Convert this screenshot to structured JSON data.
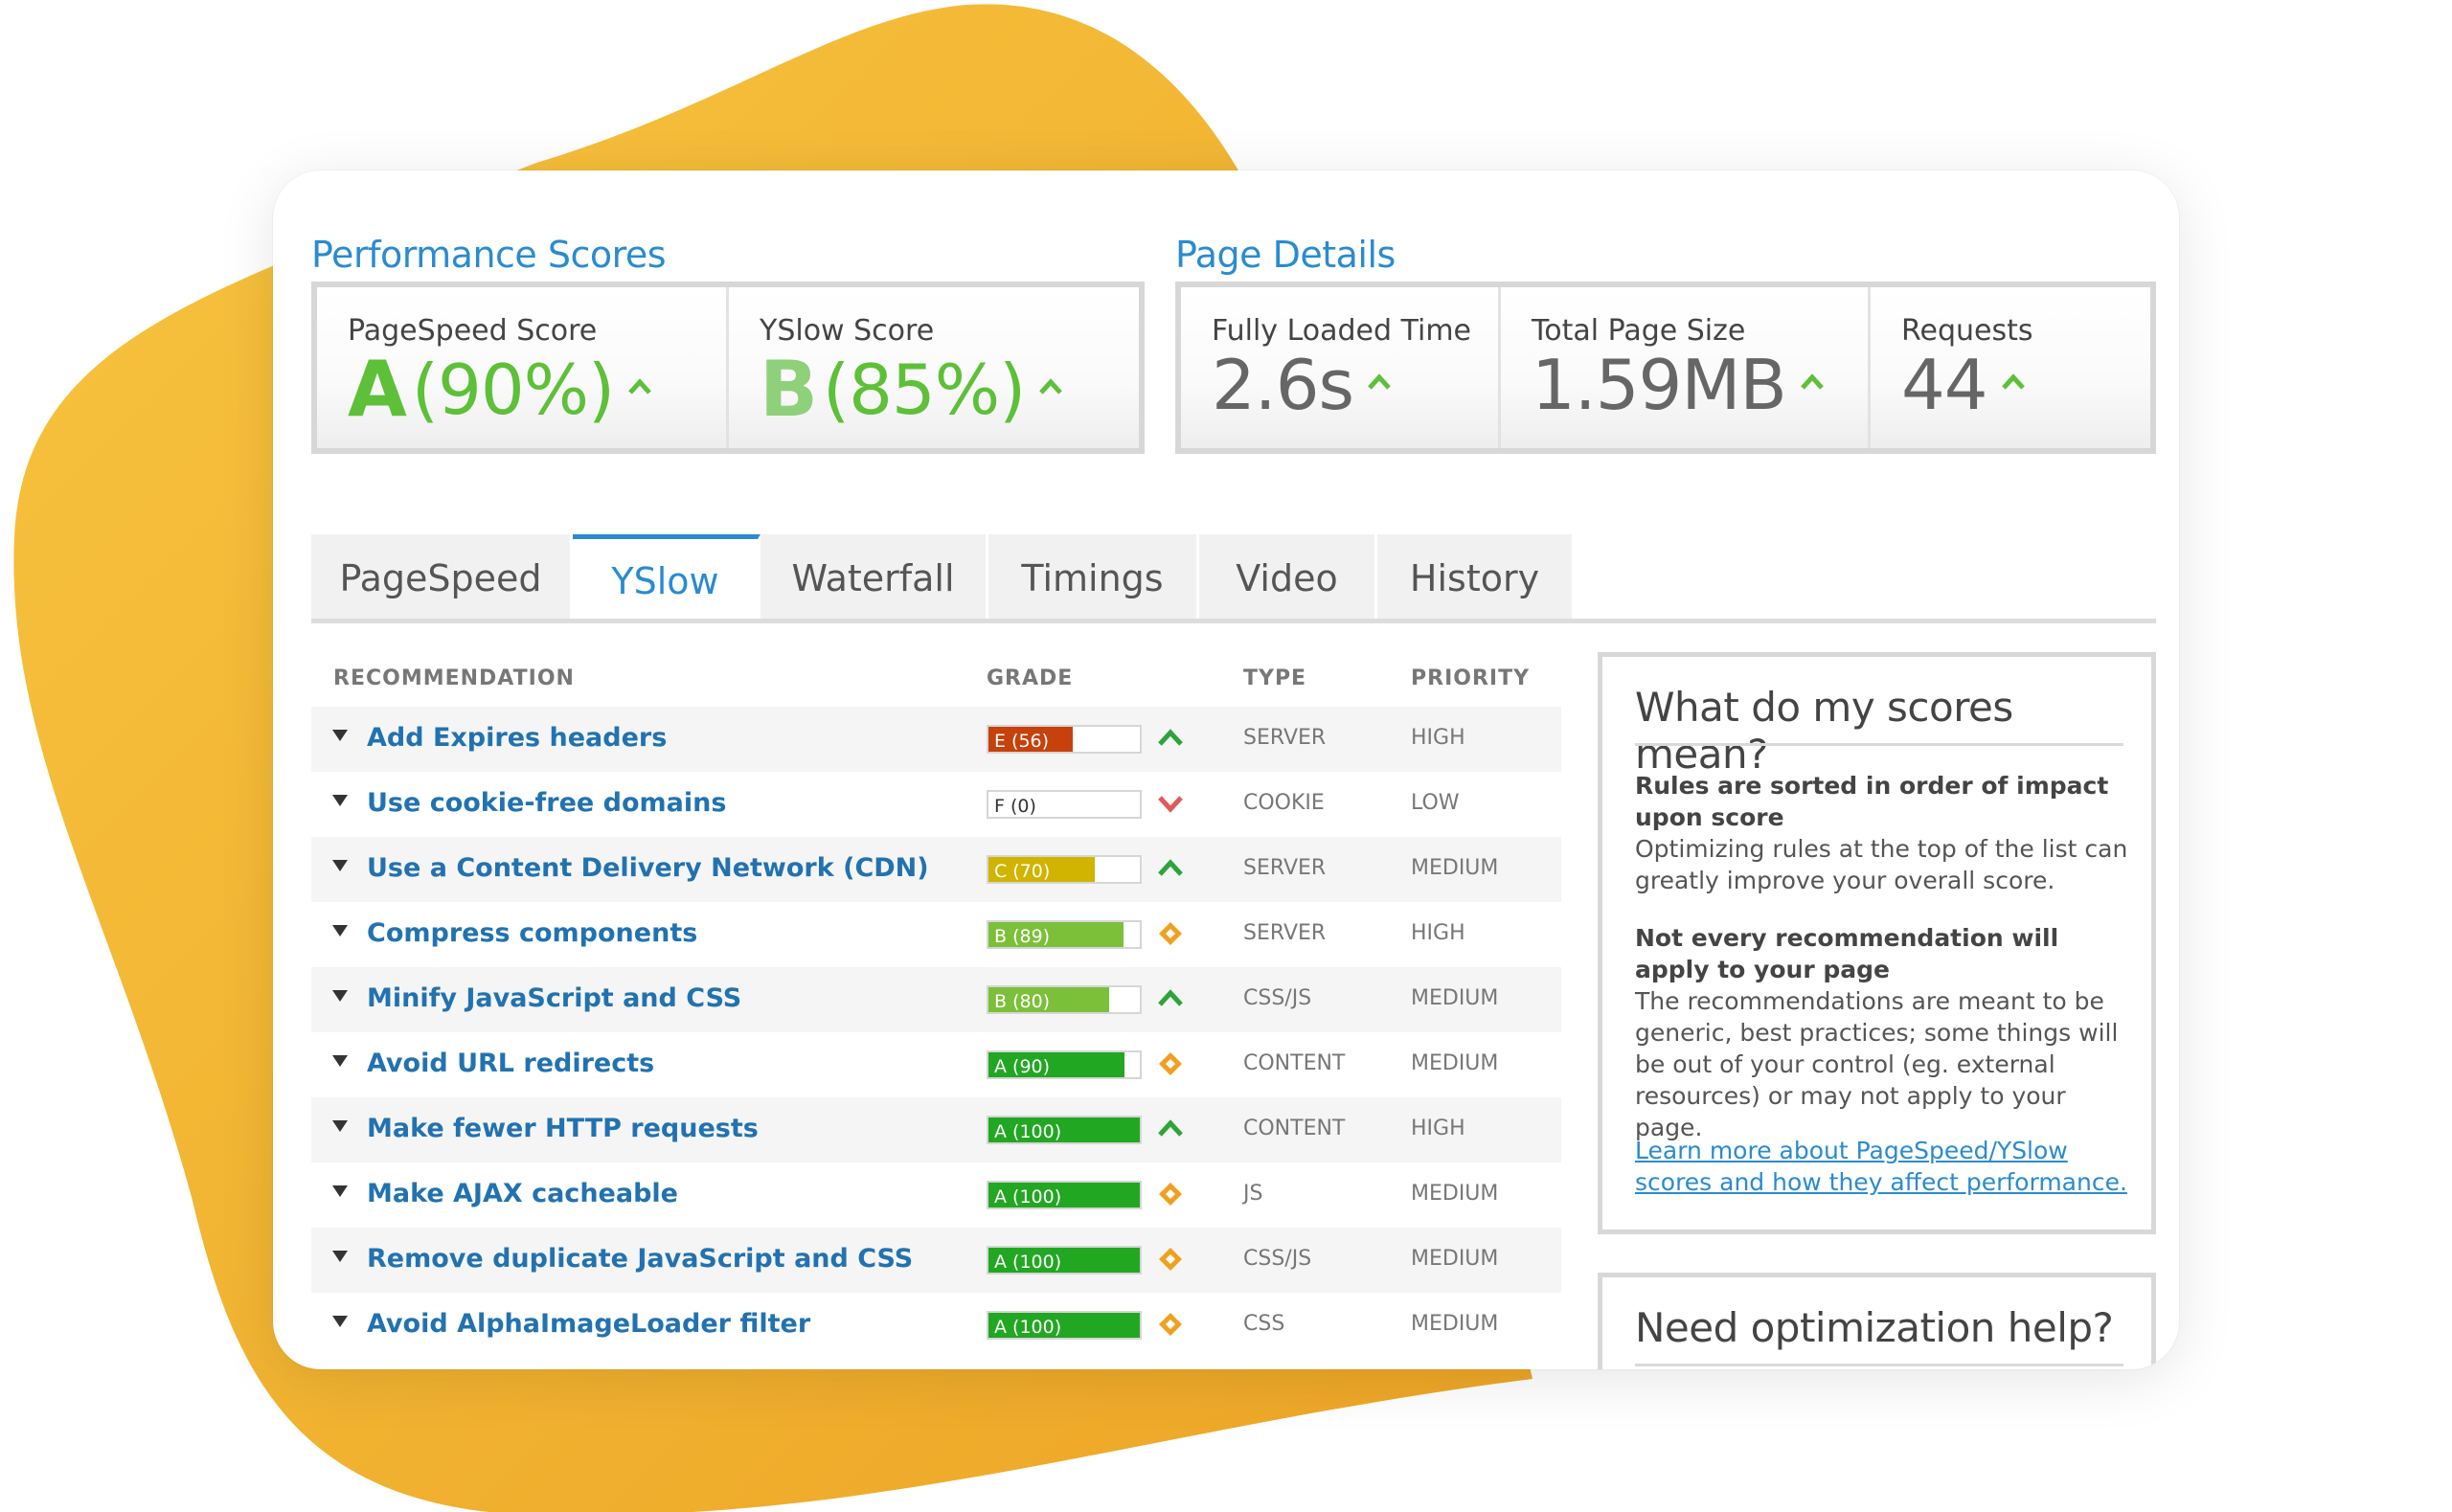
{
  "colors": {
    "blob": "#f4b733",
    "accent": "#2a8bd0",
    "green": "#5dc038",
    "red": "#e05a5a",
    "orange": "#f0a020"
  },
  "performance": {
    "title": "Performance Scores",
    "pagespeed": {
      "label": "PageSpeed Score",
      "grade": "A",
      "percent": "(90%)"
    },
    "yslow": {
      "label": "YSlow Score",
      "grade": "B",
      "percent": "(85%)"
    }
  },
  "details": {
    "title": "Page Details",
    "loaded": {
      "label": "Fully Loaded Time",
      "value": "2.6s"
    },
    "size": {
      "label": "Total Page Size",
      "value": "1.59MB"
    },
    "requests": {
      "label": "Requests",
      "value": "44"
    }
  },
  "tabs": [
    "PageSpeed",
    "YSlow",
    "Waterfall",
    "Timings",
    "Video",
    "History"
  ],
  "active_tab": "YSlow",
  "table": {
    "headers": {
      "recommendation": "RECOMMENDATION",
      "grade": "GRADE",
      "type": "TYPE",
      "priority": "PRIORITY"
    },
    "rows": [
      {
        "name": "Add Expires headers",
        "grade": "E (56)",
        "score": 56,
        "color": "#c6410b",
        "indicator": "up",
        "type": "SERVER",
        "priority": "HIGH"
      },
      {
        "name": "Use cookie-free domains",
        "grade": "F (0)",
        "score": 0,
        "color": "#c6410b",
        "indicator": "down",
        "type": "COOKIE",
        "priority": "LOW"
      },
      {
        "name": "Use a Content Delivery Network (CDN)",
        "grade": "C (70)",
        "score": 70,
        "color": "#d0b400",
        "indicator": "up",
        "type": "SERVER",
        "priority": "MEDIUM"
      },
      {
        "name": "Compress components",
        "grade": "B (89)",
        "score": 89,
        "color": "#7cc03a",
        "indicator": "diamond",
        "type": "SERVER",
        "priority": "HIGH"
      },
      {
        "name": "Minify JavaScript and CSS",
        "grade": "B (80)",
        "score": 80,
        "color": "#7cc03a",
        "indicator": "up",
        "type": "CSS/JS",
        "priority": "MEDIUM"
      },
      {
        "name": "Avoid URL redirects",
        "grade": "A (90)",
        "score": 90,
        "color": "#22a722",
        "indicator": "diamond",
        "type": "CONTENT",
        "priority": "MEDIUM"
      },
      {
        "name": "Make fewer HTTP requests",
        "grade": "A (100)",
        "score": 100,
        "color": "#22a722",
        "indicator": "up",
        "type": "CONTENT",
        "priority": "HIGH"
      },
      {
        "name": "Make AJAX cacheable",
        "grade": "A (100)",
        "score": 100,
        "color": "#22a722",
        "indicator": "diamond",
        "type": "JS",
        "priority": "MEDIUM"
      },
      {
        "name": "Remove duplicate JavaScript and CSS",
        "grade": "A (100)",
        "score": 100,
        "color": "#22a722",
        "indicator": "diamond",
        "type": "CSS/JS",
        "priority": "MEDIUM"
      },
      {
        "name": "Avoid AlphaImageLoader filter",
        "grade": "A (100)",
        "score": 100,
        "color": "#22a722",
        "indicator": "diamond",
        "type": "CSS",
        "priority": "MEDIUM"
      }
    ]
  },
  "scores_help": {
    "title": "What do my scores mean?",
    "p1_bold": "Rules are sorted in order of impact upon score",
    "p1_text": "Optimizing rules at the top of the list can greatly improve your overall score.",
    "p2_bold": "Not every recommendation will apply to your page",
    "p2_text": "The recommendations are meant to be generic, best practices; some things will be out of your control (eg. external resources) or may not apply to your page.",
    "link": "Learn more about PageSpeed/YSlow scores and how they affect performance."
  },
  "optimization_help": {
    "title": "Need optimization help?"
  }
}
